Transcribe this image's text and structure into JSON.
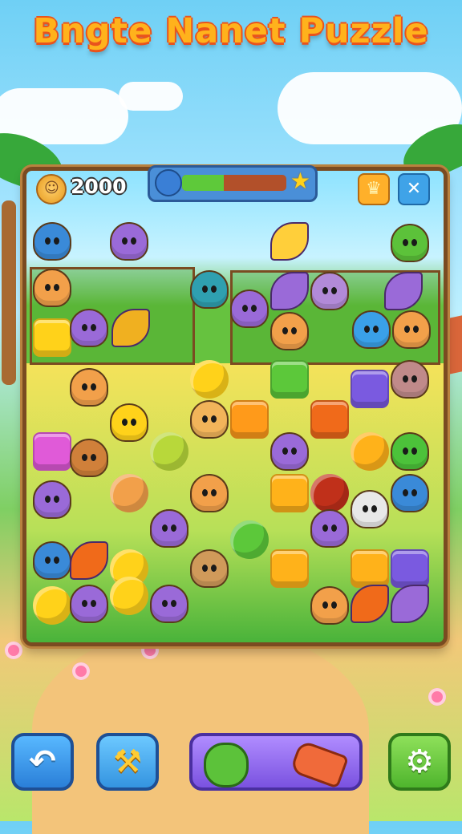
{
  "title": "Bngte Nanet Puzzle",
  "hud": {
    "score": "2000",
    "progress_fraction": 0.4,
    "icons": {
      "coin": "coin-icon",
      "progress_start": "bird-icon",
      "progress_goal": "star-icon",
      "crown_button": "crown-icon",
      "close_button": "close-icon"
    }
  },
  "board": {
    "tiles": [
      {
        "kind": "creature",
        "color": "#3a8ad8",
        "name": "blue-bird"
      },
      {
        "kind": "creature",
        "color": "#9a6ad8",
        "name": "purple-cat"
      },
      {
        "kind": "leafy",
        "color": "#ffcf3a",
        "name": "yellow-bird"
      },
      {
        "kind": "creature",
        "color": "#5cc23a",
        "name": "green-frog"
      },
      {
        "kind": "creature",
        "color": "#f2a04a",
        "name": "orange-fox"
      },
      {
        "kind": "creature",
        "color": "#2fa0b0",
        "name": "teal-fish"
      },
      {
        "kind": "creature",
        "color": "#9a6ad8",
        "name": "purple-owl"
      },
      {
        "kind": "leafy",
        "color": "#9a6ad8",
        "name": "purple-fish"
      },
      {
        "kind": "creature",
        "color": "#b28ad8",
        "name": "purple-mouse"
      },
      {
        "kind": "leafy",
        "color": "#9a6ad8",
        "name": "purple-leaf"
      },
      {
        "kind": "block",
        "color": "#ffd21a",
        "name": "yellow-block"
      },
      {
        "kind": "creature",
        "color": "#9a6ad8",
        "name": "purple-blob"
      },
      {
        "kind": "leafy",
        "color": "#f0b020",
        "name": "orange-bird"
      },
      {
        "kind": "creature",
        "color": "#f2a04a",
        "name": "orange-cat"
      },
      {
        "kind": "creature",
        "color": "#3aa0e8",
        "name": "blue-cat"
      },
      {
        "kind": "creature",
        "color": "#f2a04a",
        "name": "orange-cat"
      },
      {
        "kind": "creature",
        "color": "#f2a04a",
        "name": "orange-cat"
      },
      {
        "kind": "ball",
        "color": "#ffd21a",
        "name": "yellow-chick"
      },
      {
        "kind": "block",
        "color": "#5cc83a",
        "name": "green-block"
      },
      {
        "kind": "block",
        "color": "#7a5ae0",
        "name": "purple-block"
      },
      {
        "kind": "creature",
        "color": "#c08a8a",
        "name": "raccoon"
      },
      {
        "kind": "creature",
        "color": "#ffd21a",
        "name": "yellow-chick"
      },
      {
        "kind": "creature",
        "color": "#f2b45a",
        "name": "orange-cat"
      },
      {
        "kind": "block",
        "color": "#ff9a1a",
        "name": "orange-block"
      },
      {
        "kind": "block",
        "color": "#f06a1a",
        "name": "orange-red-block"
      },
      {
        "kind": "block",
        "color": "#e05ad8",
        "name": "pink-block"
      },
      {
        "kind": "creature",
        "color": "#d0803a",
        "name": "brown-dog"
      },
      {
        "kind": "ball",
        "color": "#b8d83a",
        "name": "lime-snail"
      },
      {
        "kind": "creature",
        "color": "#9a6ad8",
        "name": "purple-bear"
      },
      {
        "kind": "ball",
        "color": "#ffb21a",
        "name": "orange-ball"
      },
      {
        "kind": "creature",
        "color": "#4cc23a",
        "name": "green-frog"
      },
      {
        "kind": "creature",
        "color": "#9a6ad8",
        "name": "purple-cat"
      },
      {
        "kind": "ball",
        "color": "#f2a04a",
        "name": "orange-ring"
      },
      {
        "kind": "creature",
        "color": "#f2a04a",
        "name": "orange-cat"
      },
      {
        "kind": "block",
        "color": "#ffb21a",
        "name": "orange-block"
      },
      {
        "kind": "ball",
        "color": "#c0301a",
        "name": "red-ball"
      },
      {
        "kind": "creature",
        "color": "#3a8ad8",
        "name": "blue-monster"
      },
      {
        "kind": "creature",
        "color": "#f2a04a",
        "name": "orange-cat"
      },
      {
        "kind": "creature",
        "color": "#9a6ad8",
        "name": "purple-monster"
      },
      {
        "kind": "creature",
        "color": "#e8e8e8",
        "name": "white-ghost"
      },
      {
        "kind": "creature",
        "color": "#3a8ad8",
        "name": "blue-cat"
      },
      {
        "kind": "leafy",
        "color": "#f06a1a",
        "name": "orange-bird"
      },
      {
        "kind": "ball",
        "color": "#ffd21a",
        "name": "yellow-chick"
      },
      {
        "kind": "creature",
        "color": "#9a6ad8",
        "name": "purple-monster"
      },
      {
        "kind": "ball",
        "color": "#5cc83a",
        "name": "green-ball"
      },
      {
        "kind": "creature",
        "color": "#d09a5a",
        "name": "brown-monkey"
      },
      {
        "kind": "block",
        "color": "#ffb21a",
        "name": "orange-block"
      },
      {
        "kind": "block",
        "color": "#ffb21a",
        "name": "orange-block"
      },
      {
        "kind": "block",
        "color": "#7a5ae0",
        "name": "purple-block"
      },
      {
        "kind": "ball",
        "color": "#ffd21a",
        "name": "yellow-chick"
      },
      {
        "kind": "ball",
        "color": "#ffd21a",
        "name": "yellow-bird"
      },
      {
        "kind": "creature",
        "color": "#9a6ad8",
        "name": "purple-cat"
      },
      {
        "kind": "creature",
        "color": "#9a6ad8",
        "name": "purple-bear"
      },
      {
        "kind": "creature",
        "color": "#f2a04a",
        "name": "orange-cat"
      },
      {
        "kind": "leafy",
        "color": "#f06a1a",
        "name": "red-fish"
      },
      {
        "kind": "leafy",
        "color": "#9a6ad8",
        "name": "purple-leaf"
      }
    ]
  },
  "buttons": {
    "back": {
      "icon": "back-arrow-icon",
      "glyph": "↶"
    },
    "hint": {
      "icon": "hammer-icon",
      "glyph": "⚒"
    },
    "power": {
      "left_icon": "green-monster-icon",
      "right_icon": "whistle-icon"
    },
    "settings": {
      "icon": "gear-icon",
      "glyph": "⚙"
    }
  },
  "colors": {
    "accent_orange": "#ffb21c",
    "title_outline": "#e9531d",
    "board_frame": "#7a4b21",
    "progress_fill": "#5ec93a"
  }
}
